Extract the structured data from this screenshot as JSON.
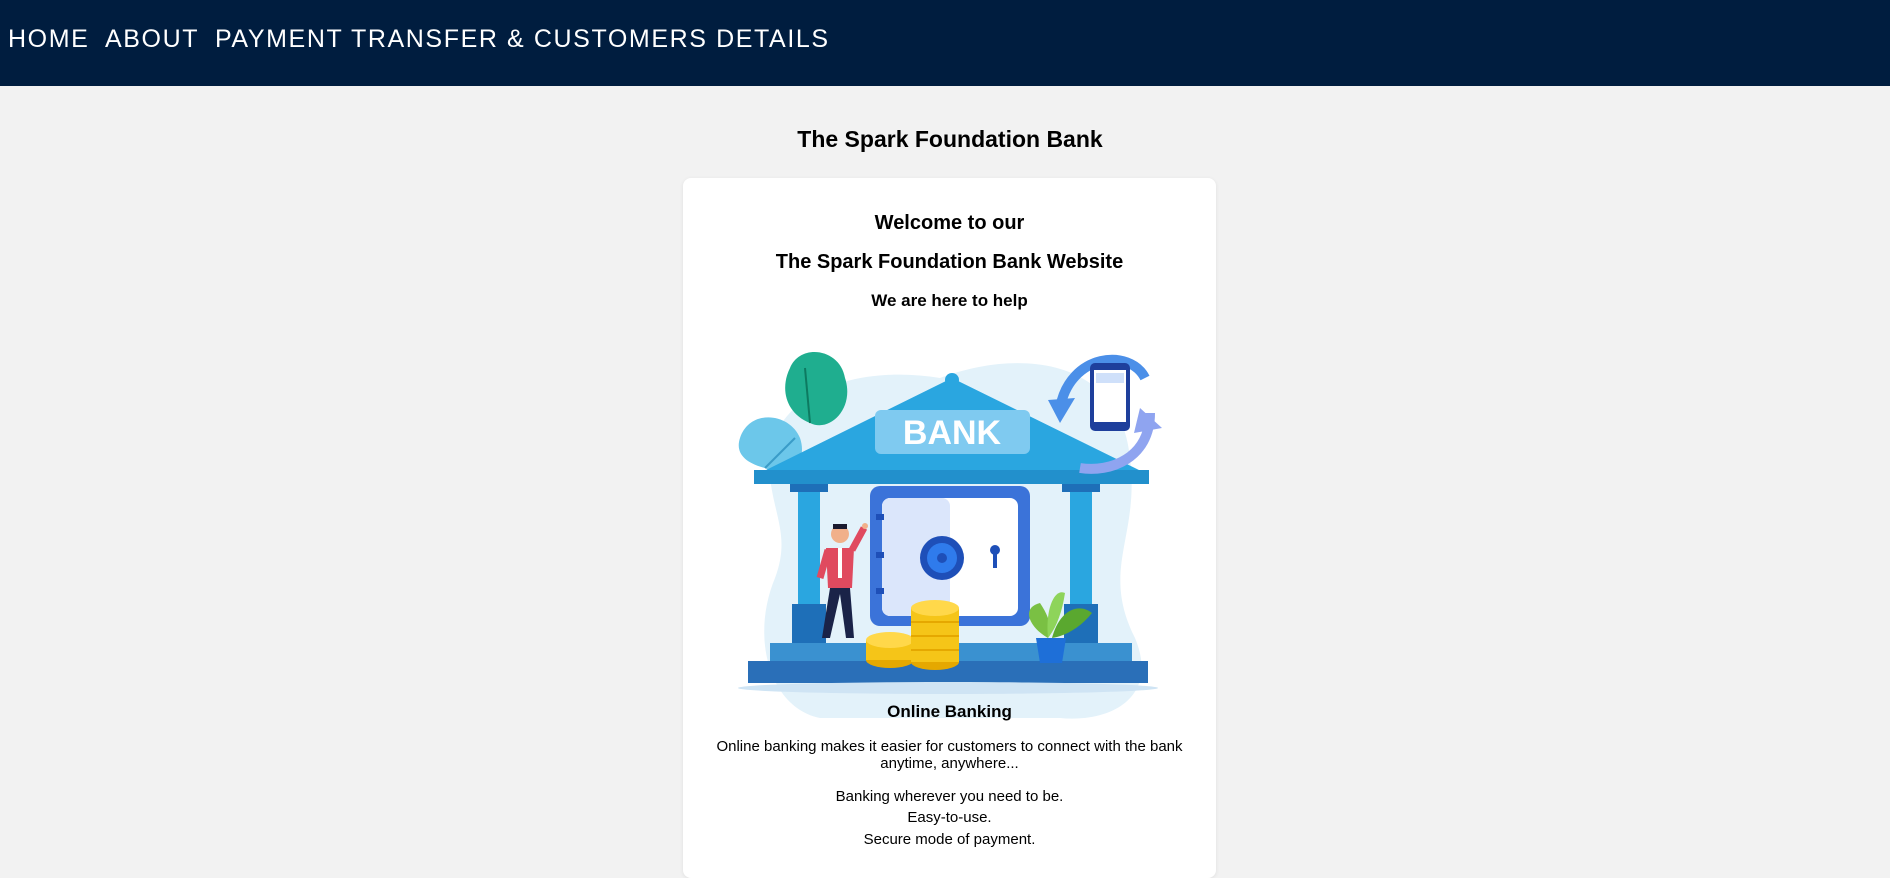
{
  "nav": {
    "home": "HOME",
    "about": "ABOUT",
    "payment": "PAYMENT TRANSFER & CUSTOMERS DETAILS"
  },
  "page": {
    "title": "The Spark Foundation Bank"
  },
  "card": {
    "welcome_line1": "Welcome to our",
    "welcome_line2": "The Spark Foundation Bank Website",
    "welcome_line3": "We are here to help",
    "illustration_sign": "BANK",
    "online_title": "Online Banking",
    "online_desc": "Online banking makes it easier for customers to connect with the bank anytime, anywhere...",
    "bullets": [
      "Banking wherever you need to be.",
      "Easy-to-use.",
      "Secure mode of payment."
    ]
  },
  "colors": {
    "navbar": "#001d3f",
    "page_bg": "#f2f2f2",
    "card_bg": "#ffffff",
    "bank_blue": "#2aa6e0",
    "vault_blue": "#3b73d9",
    "coin_gold": "#f5c518"
  }
}
